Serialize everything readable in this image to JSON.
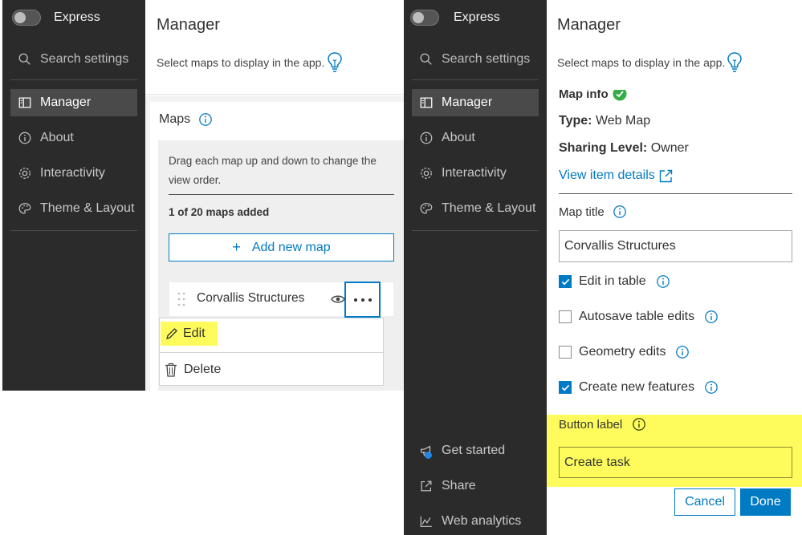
{
  "left": {
    "sidebar": {
      "toggle_label": "Express",
      "search_placeholder": "Search settings",
      "items": [
        {
          "label": "Manager",
          "active": true
        },
        {
          "label": "About"
        },
        {
          "label": "Interactivity"
        },
        {
          "label": "Theme & Layout"
        }
      ]
    },
    "main": {
      "title": "Manager",
      "subtitle": "Select maps to display in the app.",
      "maps": {
        "heading": "Maps",
        "hint": "Drag each map up and down to change the view order.",
        "count": "1 of 20 maps added",
        "add_button": "Add new map",
        "map_name": "Corvallis Structures",
        "menu": {
          "edit": "Edit",
          "delete": "Delete"
        }
      }
    }
  },
  "right": {
    "sidebar": {
      "toggle_label": "Express",
      "search_placeholder": "Search settings",
      "items": [
        {
          "label": "Manager",
          "active": true
        },
        {
          "label": "About"
        },
        {
          "label": "Interactivity"
        },
        {
          "label": "Theme & Layout"
        }
      ],
      "bottom_items": [
        {
          "label": "Get started"
        },
        {
          "label": "Share"
        },
        {
          "label": "Web analytics"
        }
      ]
    },
    "main": {
      "title": "Manager",
      "subtitle": "Select maps to display in the app.",
      "map_info": {
        "heading": "Map info",
        "type_label": "Type:",
        "type_value": "Web Map",
        "sharing_label": "Sharing Level:",
        "sharing_value": "Owner",
        "view_details": "View item details"
      },
      "map_title_label": "Map title",
      "map_title_value": "Corvallis Structures",
      "options": [
        {
          "label": "Edit in table",
          "checked": true
        },
        {
          "label": "Autosave table edits",
          "checked": false
        },
        {
          "label": "Geometry edits",
          "checked": false
        },
        {
          "label": "Create new features",
          "checked": true
        }
      ],
      "button_label_label": "Button label",
      "button_label_value": "Create task",
      "cancel": "Cancel",
      "done": "Done"
    }
  },
  "colors": {
    "accent": "#007ac2",
    "highlight": "#fdfc5c",
    "sidebar": "#2b2b2b",
    "success": "#35ac46"
  }
}
